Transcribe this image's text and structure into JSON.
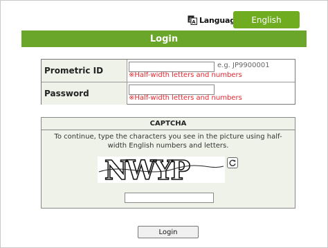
{
  "header": {
    "language_label": "Language",
    "language_button": "English"
  },
  "login_bar": {
    "title": "Login"
  },
  "credentials": {
    "id_label": "Prometric ID",
    "id_value": "",
    "id_example": "e.g. JP9900001",
    "id_note": "※Half-width letters and numbers",
    "password_label": "Password",
    "password_value": "",
    "password_note": "※Half-width letters and numbers"
  },
  "captcha": {
    "heading": "CAPTCHA",
    "instructions": "To continue, type the characters you see in the picture using half-width English numbers and letters.",
    "image_text": "NWYP",
    "input_value": ""
  },
  "submit": {
    "label": "Login"
  }
}
